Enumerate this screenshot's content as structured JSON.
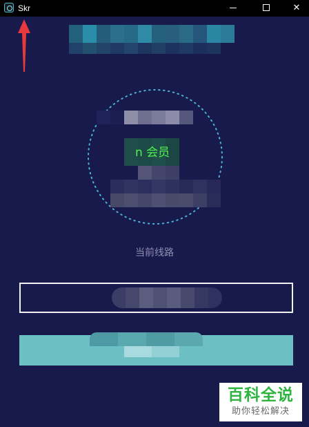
{
  "window": {
    "title": "Skr"
  },
  "controls": {
    "minimize": "minimize-icon",
    "maximize": "maximize-icon",
    "close": "close-icon",
    "close_glyph": "✕"
  },
  "status": {
    "membership_text": "n 会员"
  },
  "route": {
    "label": "当前线路"
  },
  "watermark": {
    "title": "百科全说",
    "subtitle": "助你轻松解决"
  },
  "colors": {
    "background": "#191a4c",
    "titlebar": "#000000",
    "accent_ring": "#4ab3d8",
    "membership_text": "#50f04d",
    "connect_button": "#6cc0c4",
    "arrow": "#e8393f"
  }
}
